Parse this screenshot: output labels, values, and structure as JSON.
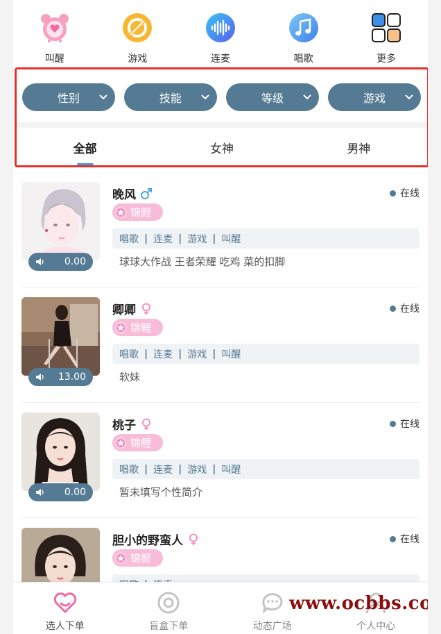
{
  "top_icons": [
    {
      "label": "叫醒",
      "icon": "alarm-clock-icon",
      "color": "#f7a0bf"
    },
    {
      "label": "游戏",
      "icon": "game-icon",
      "color": "#f7b733"
    },
    {
      "label": "连麦",
      "icon": "soundwave-icon",
      "color": "#4a8df0"
    },
    {
      "label": "唱歌",
      "icon": "music-note-icon",
      "color": "#5ba0f2"
    },
    {
      "label": "更多",
      "icon": "more-grid-icon",
      "color": "#3d8fe8"
    }
  ],
  "filters": [
    {
      "label": "性别"
    },
    {
      "label": "技能"
    },
    {
      "label": "等级"
    },
    {
      "label": "游戏"
    }
  ],
  "tabs": [
    {
      "label": "全部",
      "active": true
    },
    {
      "label": "女神",
      "active": false
    },
    {
      "label": "男神",
      "active": false
    }
  ],
  "users": [
    {
      "name": "晚风",
      "gender": "male",
      "badge": "锦鲤",
      "status": "在线",
      "skills": [
        "唱歌",
        "连麦",
        "游戏",
        "叫醒"
      ],
      "bio": "球球大作战 王者荣耀 吃鸡 菜的扣脚",
      "voice_value": "0.00"
    },
    {
      "name": "卿卿",
      "gender": "female",
      "badge": "锦鲤",
      "status": "在线",
      "skills": [
        "唱歌",
        "连麦",
        "游戏",
        "叫醒"
      ],
      "bio": "软妹",
      "voice_value": "13.00"
    },
    {
      "name": "桃子",
      "gender": "female",
      "badge": "锦鲤",
      "status": "在线",
      "skills": [
        "唱歌",
        "连麦",
        "游戏",
        "叫醒"
      ],
      "bio": "暂未填写个性简介",
      "voice_value": "0.00"
    },
    {
      "name": "胆小的野蛮人",
      "gender": "female",
      "badge": "锦鲤",
      "status": "在线",
      "skills": [
        "唱歌",
        "连麦"
      ],
      "bio": "",
      "voice_value": ""
    }
  ],
  "nav": [
    {
      "label": "选人下单",
      "icon": "heart-icon",
      "active": true
    },
    {
      "label": "盲盒下单",
      "icon": "blind-box-icon",
      "active": false
    },
    {
      "label": "动态广场",
      "icon": "chat-bubble-icon",
      "active": false
    },
    {
      "label": "个人中心",
      "icon": "person-icon",
      "active": false
    }
  ],
  "watermark": "www.ocbbs.com",
  "colors": {
    "accent": "#557a93",
    "badge": "#f8bcd9",
    "male": "#4aa3e8",
    "female": "#f48fc1",
    "highlight_border": "#e8302a"
  }
}
